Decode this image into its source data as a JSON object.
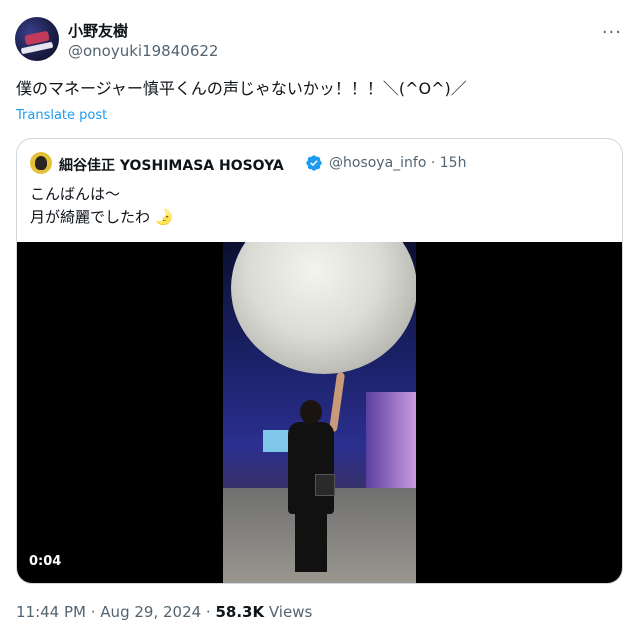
{
  "author": {
    "display_name": "小野友樹",
    "handle": "@onoyuki19840622"
  },
  "tweet": {
    "text": "僕のマネージャー慎平くんの声じゃないかッ！！！＼(^O^)／",
    "translate_label": "Translate post"
  },
  "quote": {
    "display_name": "細谷佳正 YOSHIMASA HOSOYA",
    "handle_time": "@hosoya_info · 15h",
    "line1": "こんばんは〜",
    "line2": "月が綺麗でしたわ 🌛",
    "video_duration": "0:04"
  },
  "meta": {
    "time": "11:44 PM",
    "separator1": " · ",
    "date": "Aug 29, 2024",
    "separator2": " · ",
    "views_count": "58.3K",
    "views_label": " Views"
  },
  "colors": {
    "accent": "#1d9bf0",
    "secondary_text": "#536471",
    "border": "#cfd9de"
  },
  "icons": {
    "more": "more-options-icon",
    "verified": "verified-badge-icon"
  }
}
